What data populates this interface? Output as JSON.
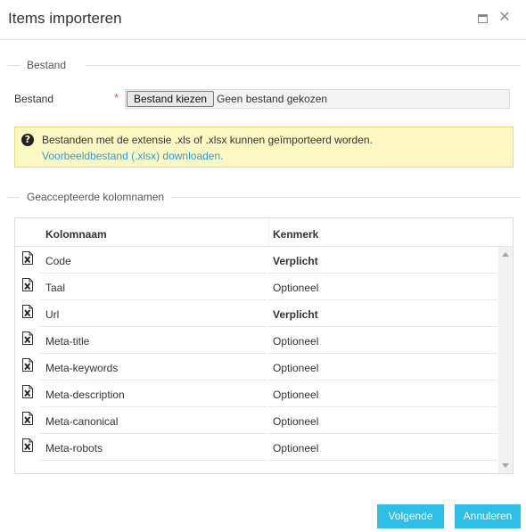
{
  "window": {
    "title": "Items importeren",
    "maximize_icon": "maximize-icon",
    "close_icon": "close-icon",
    "close_glyph": "✕"
  },
  "file_section": {
    "legend": "Bestand",
    "field_label": "Bestand",
    "required_mark": "*",
    "choose_button": "Bestand kiezen",
    "file_status": "Geen bestand gekozen"
  },
  "info": {
    "icon": "question-icon",
    "icon_glyph": "?",
    "text": "Bestanden met de extensie .xls of .xlsx kunnen geïmporteerd worden.",
    "link": "Voorbeeldbestand (.xlsx) downloaden.",
    "background_color": "#fcf8c4",
    "link_color": "#2a9fd6"
  },
  "columns_section": {
    "legend": "Geaccepteerde kolomnamen",
    "headers": {
      "name": "Kolomnaam",
      "attribute": "Kenmerk"
    },
    "row_icon": "excel-file-icon",
    "rows": [
      {
        "name": "Code",
        "attribute": "Verplicht",
        "required": true
      },
      {
        "name": "Taal",
        "attribute": "Optioneel",
        "required": false
      },
      {
        "name": "Url",
        "attribute": "Verplicht",
        "required": true
      },
      {
        "name": "Meta-title",
        "attribute": "Optioneel",
        "required": false
      },
      {
        "name": "Meta-keywords",
        "attribute": "Optioneel",
        "required": false
      },
      {
        "name": "Meta-description",
        "attribute": "Optioneel",
        "required": false
      },
      {
        "name": "Meta-canonical",
        "attribute": "Optioneel",
        "required": false
      },
      {
        "name": "Meta-robots",
        "attribute": "Optioneel",
        "required": false
      }
    ]
  },
  "footer": {
    "next_button": "Volgende",
    "cancel_button": "Annuleren",
    "button_color": "#2ebfe8"
  }
}
